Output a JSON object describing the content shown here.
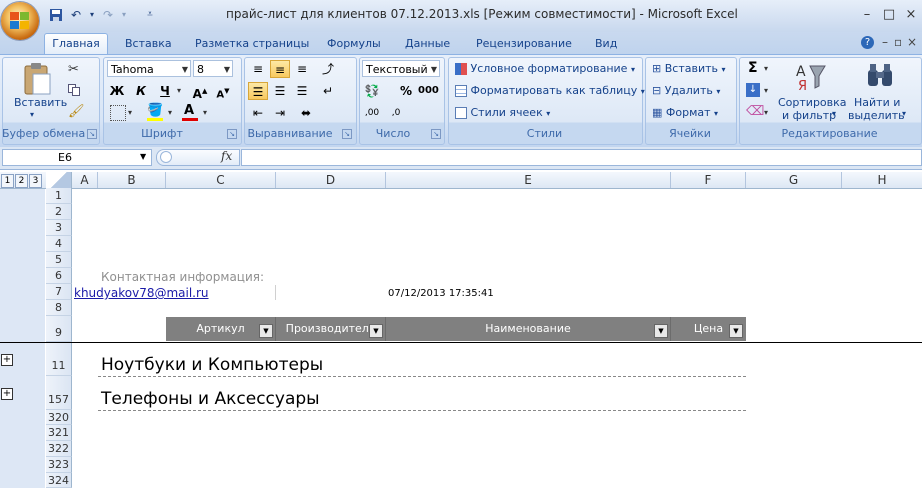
{
  "window": {
    "title": "прайс-лист для клиентов 07.12.2013.xls  [Режим совместимости]  -  Microsoft Excel",
    "controls": [
      "–",
      "□",
      "×"
    ]
  },
  "ribbon": {
    "tabs": [
      "Главная",
      "Вставка",
      "Разметка страницы",
      "Формулы",
      "Данные",
      "Рецензирование",
      "Вид"
    ],
    "clipboard": {
      "paste": "Вставить",
      "label": "Буфер обмена"
    },
    "font": {
      "name": "Tahoma",
      "size": "8",
      "bold": "Ж",
      "italic": "К",
      "underline": "Ч",
      "label": "Шрифт"
    },
    "alignment": {
      "label": "Выравнивание"
    },
    "number": {
      "format": "Текстовый",
      "label": "Число"
    },
    "styles": {
      "conditional": "Условное форматирование",
      "table": "Форматировать как таблицу",
      "cell_styles": "Стили ячеек",
      "label": "Стили"
    },
    "cells": {
      "insert": "Вставить",
      "delete": "Удалить",
      "format": "Формат",
      "label": "Ячейки"
    },
    "editing": {
      "sort": "Сортировка",
      "sort2": "и фильтр",
      "find": "Найти и",
      "find2": "выделить",
      "label": "Редактирование"
    }
  },
  "formula_bar": {
    "name_box": "E6",
    "fx": "fx",
    "value": ""
  },
  "sheet": {
    "outline_levels": [
      "1",
      "2",
      "3"
    ],
    "columns": [
      "A",
      "B",
      "C",
      "D",
      "E",
      "F",
      "G",
      "H"
    ],
    "rows": [
      "1",
      "2",
      "3",
      "4",
      "5",
      "6",
      "7",
      "8",
      "9",
      "11",
      "157",
      "320",
      "321",
      "322",
      "323",
      "324"
    ],
    "contact_label": "Контактная информация:",
    "email": "khudyakov78@mail.ru",
    "timestamp": "07/12/2013 17:35:41",
    "table_headers": [
      "Артикул",
      "Производитель",
      "Наименование",
      "Цена"
    ],
    "groups": [
      "Ноутбуки и Компьютеры",
      "Телефоны и Аксессуары"
    ]
  },
  "colors": {
    "header_gray": "#808080",
    "ribbon_blue": "#dbe6f4",
    "text_blue": "#15428b"
  }
}
